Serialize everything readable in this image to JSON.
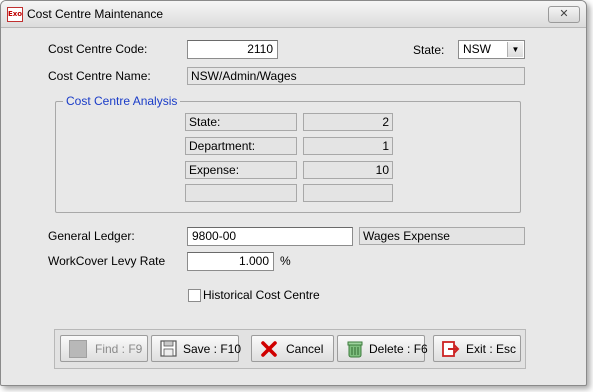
{
  "window": {
    "title": "Cost Centre Maintenance",
    "app_icon": "Exo",
    "close": "✕"
  },
  "form": {
    "cost_centre_code_label": "Cost Centre Code:",
    "cost_centre_code": "2110",
    "state_label": "State:",
    "state_value": "NSW",
    "cost_centre_name_label": "Cost Centre Name:",
    "cost_centre_name": "NSW/Admin/Wages",
    "analysis": {
      "title": "Cost Centre Analysis",
      "rows": [
        {
          "label": "State:",
          "value": "2"
        },
        {
          "label": "Department:",
          "value": "1"
        },
        {
          "label": "Expense:",
          "value": "10"
        },
        {
          "label": "",
          "value": ""
        }
      ]
    },
    "general_ledger_label": "General Ledger:",
    "general_ledger_code": "9800-00",
    "general_ledger_name": "Wages Expense",
    "workcover_label": "WorkCover Levy Rate",
    "workcover_value": "1.000",
    "workcover_unit": "%",
    "historical_label": "Historical Cost Centre",
    "historical_checked": false
  },
  "buttons": {
    "find": "Find : F9",
    "save": "Save : F10",
    "cancel": "Cancel",
    "delete": "Delete : F6",
    "exit": "Exit : Esc"
  },
  "icons": {
    "find": "find-icon",
    "save": "save-icon",
    "cancel": "cancel-x-icon",
    "delete": "delete-icon",
    "exit": "exit-icon"
  },
  "colors": {
    "group_title": "#1a3cc8",
    "cancel_red": "#d00000",
    "exit_red": "#cc2222"
  }
}
